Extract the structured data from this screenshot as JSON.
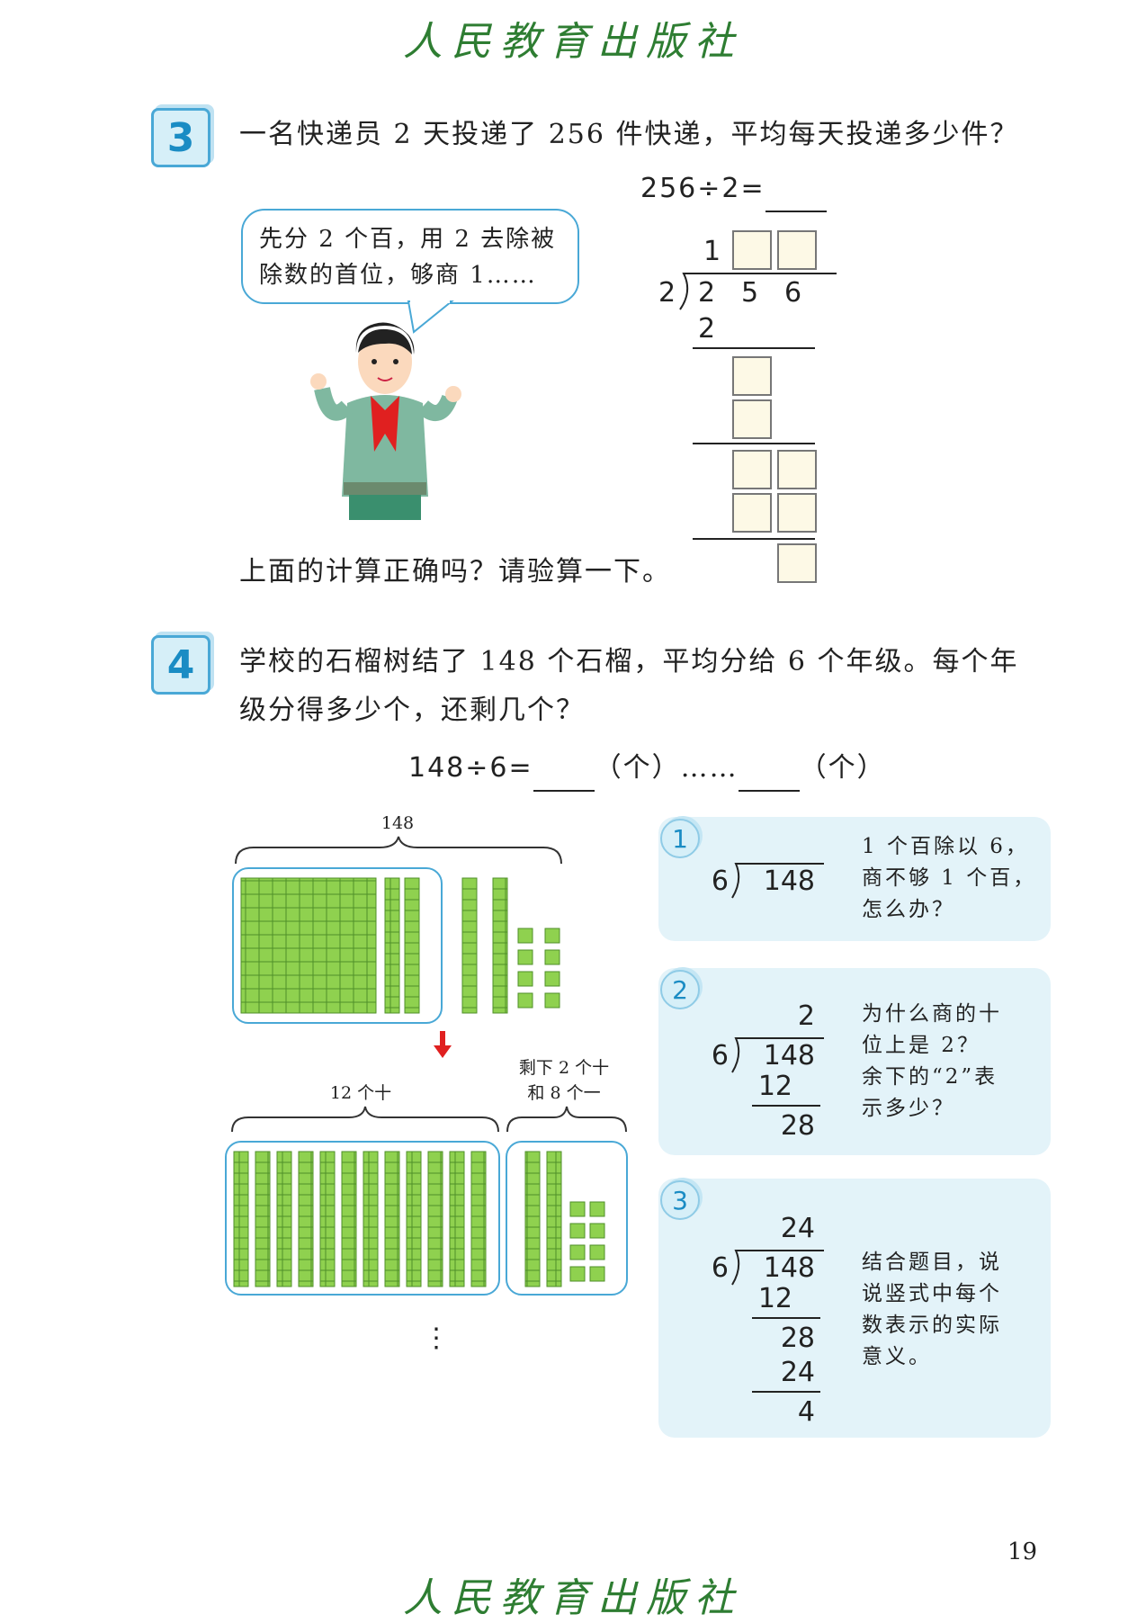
{
  "header": {
    "publisher": "人民教育出版社"
  },
  "footer": {
    "publisher": "人民教育出版社",
    "page_number": "19"
  },
  "colors": {
    "accent_blue": "#49a8d6",
    "block_green": "#8fd14f",
    "panel_bg": "#e3f3f9",
    "arrow_red": "#e02020"
  },
  "problem3": {
    "number": "3",
    "text": "一名快递员 2 天投递了 256 件快递，平均每天投递多少件？",
    "equation": "256÷2=",
    "bubble": "先分 2 个百，用 2 去除被除数的首位，够商 1……",
    "division": {
      "quotient_first": "1",
      "divisor": "2",
      "dividend": [
        "2",
        "5",
        "6"
      ],
      "first_product": "2"
    },
    "check_prompt": "上面的计算正确吗？请验算一下。",
    "illustration": "boy-student-with-red-scarf"
  },
  "problem4": {
    "number": "4",
    "text_line1": "学校的石榴树结了 148 个石榴，平均分给 6 个年级。每个年",
    "text_line2": "级分得多少个，还剩几个？",
    "equation_left": "148÷6=",
    "unit1": "（个）……",
    "unit2": "（个）",
    "blocks": {
      "total_label": "148",
      "tens_label": "12 个十",
      "remainder_label_1": "剩下 2 个十",
      "remainder_label_2": "和 8 个一",
      "ellipsis": "⋮"
    },
    "steps": [
      {
        "num": "1",
        "divisor": "6",
        "dividend": "148",
        "lines": [],
        "note": [
          "1 个百除以 6，",
          "商不够 1 个百，",
          "怎么办？"
        ]
      },
      {
        "num": "2",
        "divisor": "6",
        "dividend": "148",
        "quotient": "2",
        "lines": [
          "12",
          "28"
        ],
        "note": [
          "为什么商的十",
          "位上是 2？",
          "余下的“2”表",
          "示多少？"
        ]
      },
      {
        "num": "3",
        "divisor": "6",
        "dividend": "148",
        "quotient": "24",
        "lines": [
          "12",
          "28",
          "24",
          "4"
        ],
        "note": [
          "结合题目，说",
          "说竖式中每个",
          "数表示的实际",
          "意义。"
        ]
      }
    ]
  }
}
